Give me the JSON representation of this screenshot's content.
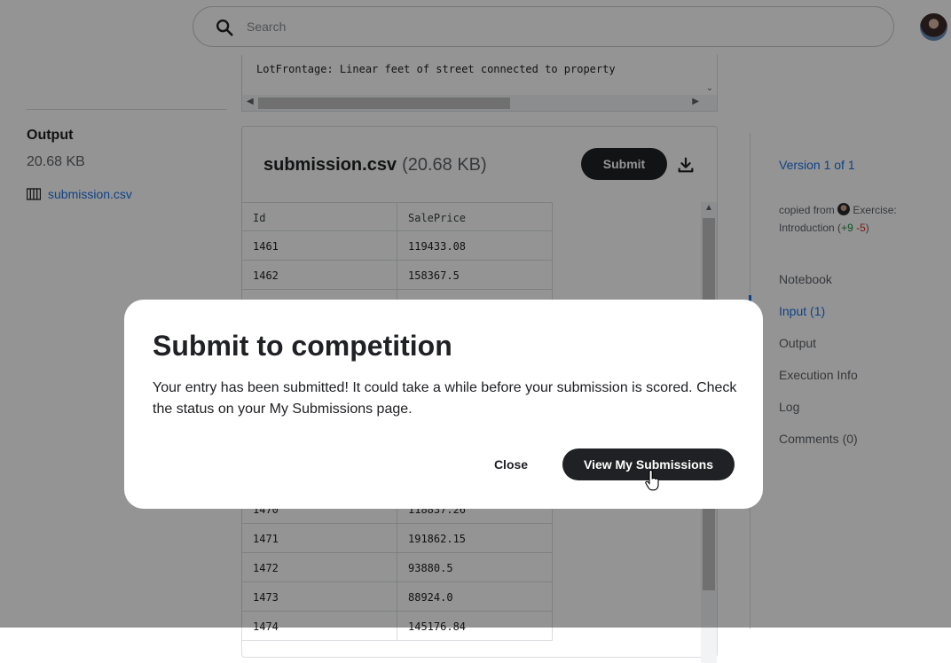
{
  "search": {
    "placeholder": "Search"
  },
  "left": {
    "title": "Output",
    "size": "20.68 KB",
    "file_link": "submission.csv"
  },
  "code": {
    "line": "LotFrontage: Linear feet of street connected to property"
  },
  "file_panel": {
    "name": "submission.csv",
    "size": "(20.68 KB)",
    "submit_label": "Submit",
    "columns": [
      "Id",
      "SalePrice"
    ],
    "rows_top": [
      [
        "1461",
        "119433.08"
      ],
      [
        "1462",
        "158367.5"
      ]
    ],
    "rows_bottom": [
      [
        "1470",
        "118837.26"
      ],
      [
        "1471",
        "191862.15"
      ],
      [
        "1472",
        "93880.5"
      ],
      [
        "1473",
        "88924.0"
      ],
      [
        "1474",
        "145176.84"
      ]
    ]
  },
  "right": {
    "version": "Version 1 of 1",
    "copied_from": "copied from",
    "copied_source": "Exercise: Introduction",
    "plus": "+9",
    "minus": "-5",
    "nav": [
      "Notebook",
      "Input (1)",
      "Output",
      "Execution Info",
      "Log",
      "Comments (0)"
    ],
    "active_nav": "Input (1)"
  },
  "modal": {
    "title": "Submit to competition",
    "body": "Your entry has been submitted! It could take a while before your submission is scored. Check the status on your My Submissions page.",
    "close_label": "Close",
    "view_label": "View My Submissions"
  },
  "colors": {
    "accent": "#1a73e8",
    "dark_button": "#202124",
    "plus": "#1e8e3e",
    "minus": "#d93025"
  }
}
